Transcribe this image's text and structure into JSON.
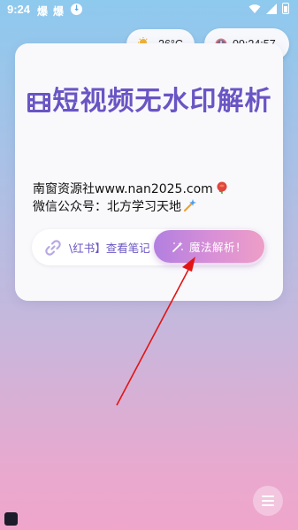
{
  "status_bar": {
    "time": "9:24",
    "app_icon_1": "爆",
    "app_icon_2": "爆",
    "download_icon": "download-icon"
  },
  "weather": {
    "icon": "partly-cloudy-icon",
    "temperature": "26°C"
  },
  "clock": {
    "icon": "clock-icon",
    "time": "09:24:57"
  },
  "card": {
    "title": "短视频无水印解析",
    "info_line_1": "南窗资源社www.nan2025.com",
    "info_line_2": "微信公众号：北方学习天地",
    "search_value": "\\红书】查看笔记",
    "magic_button_label": "魔法解析！"
  },
  "colors": {
    "accent": "#6a55c4",
    "button_start": "#b27fe0",
    "button_end": "#ee9ec6",
    "arrow": "#e21414"
  }
}
